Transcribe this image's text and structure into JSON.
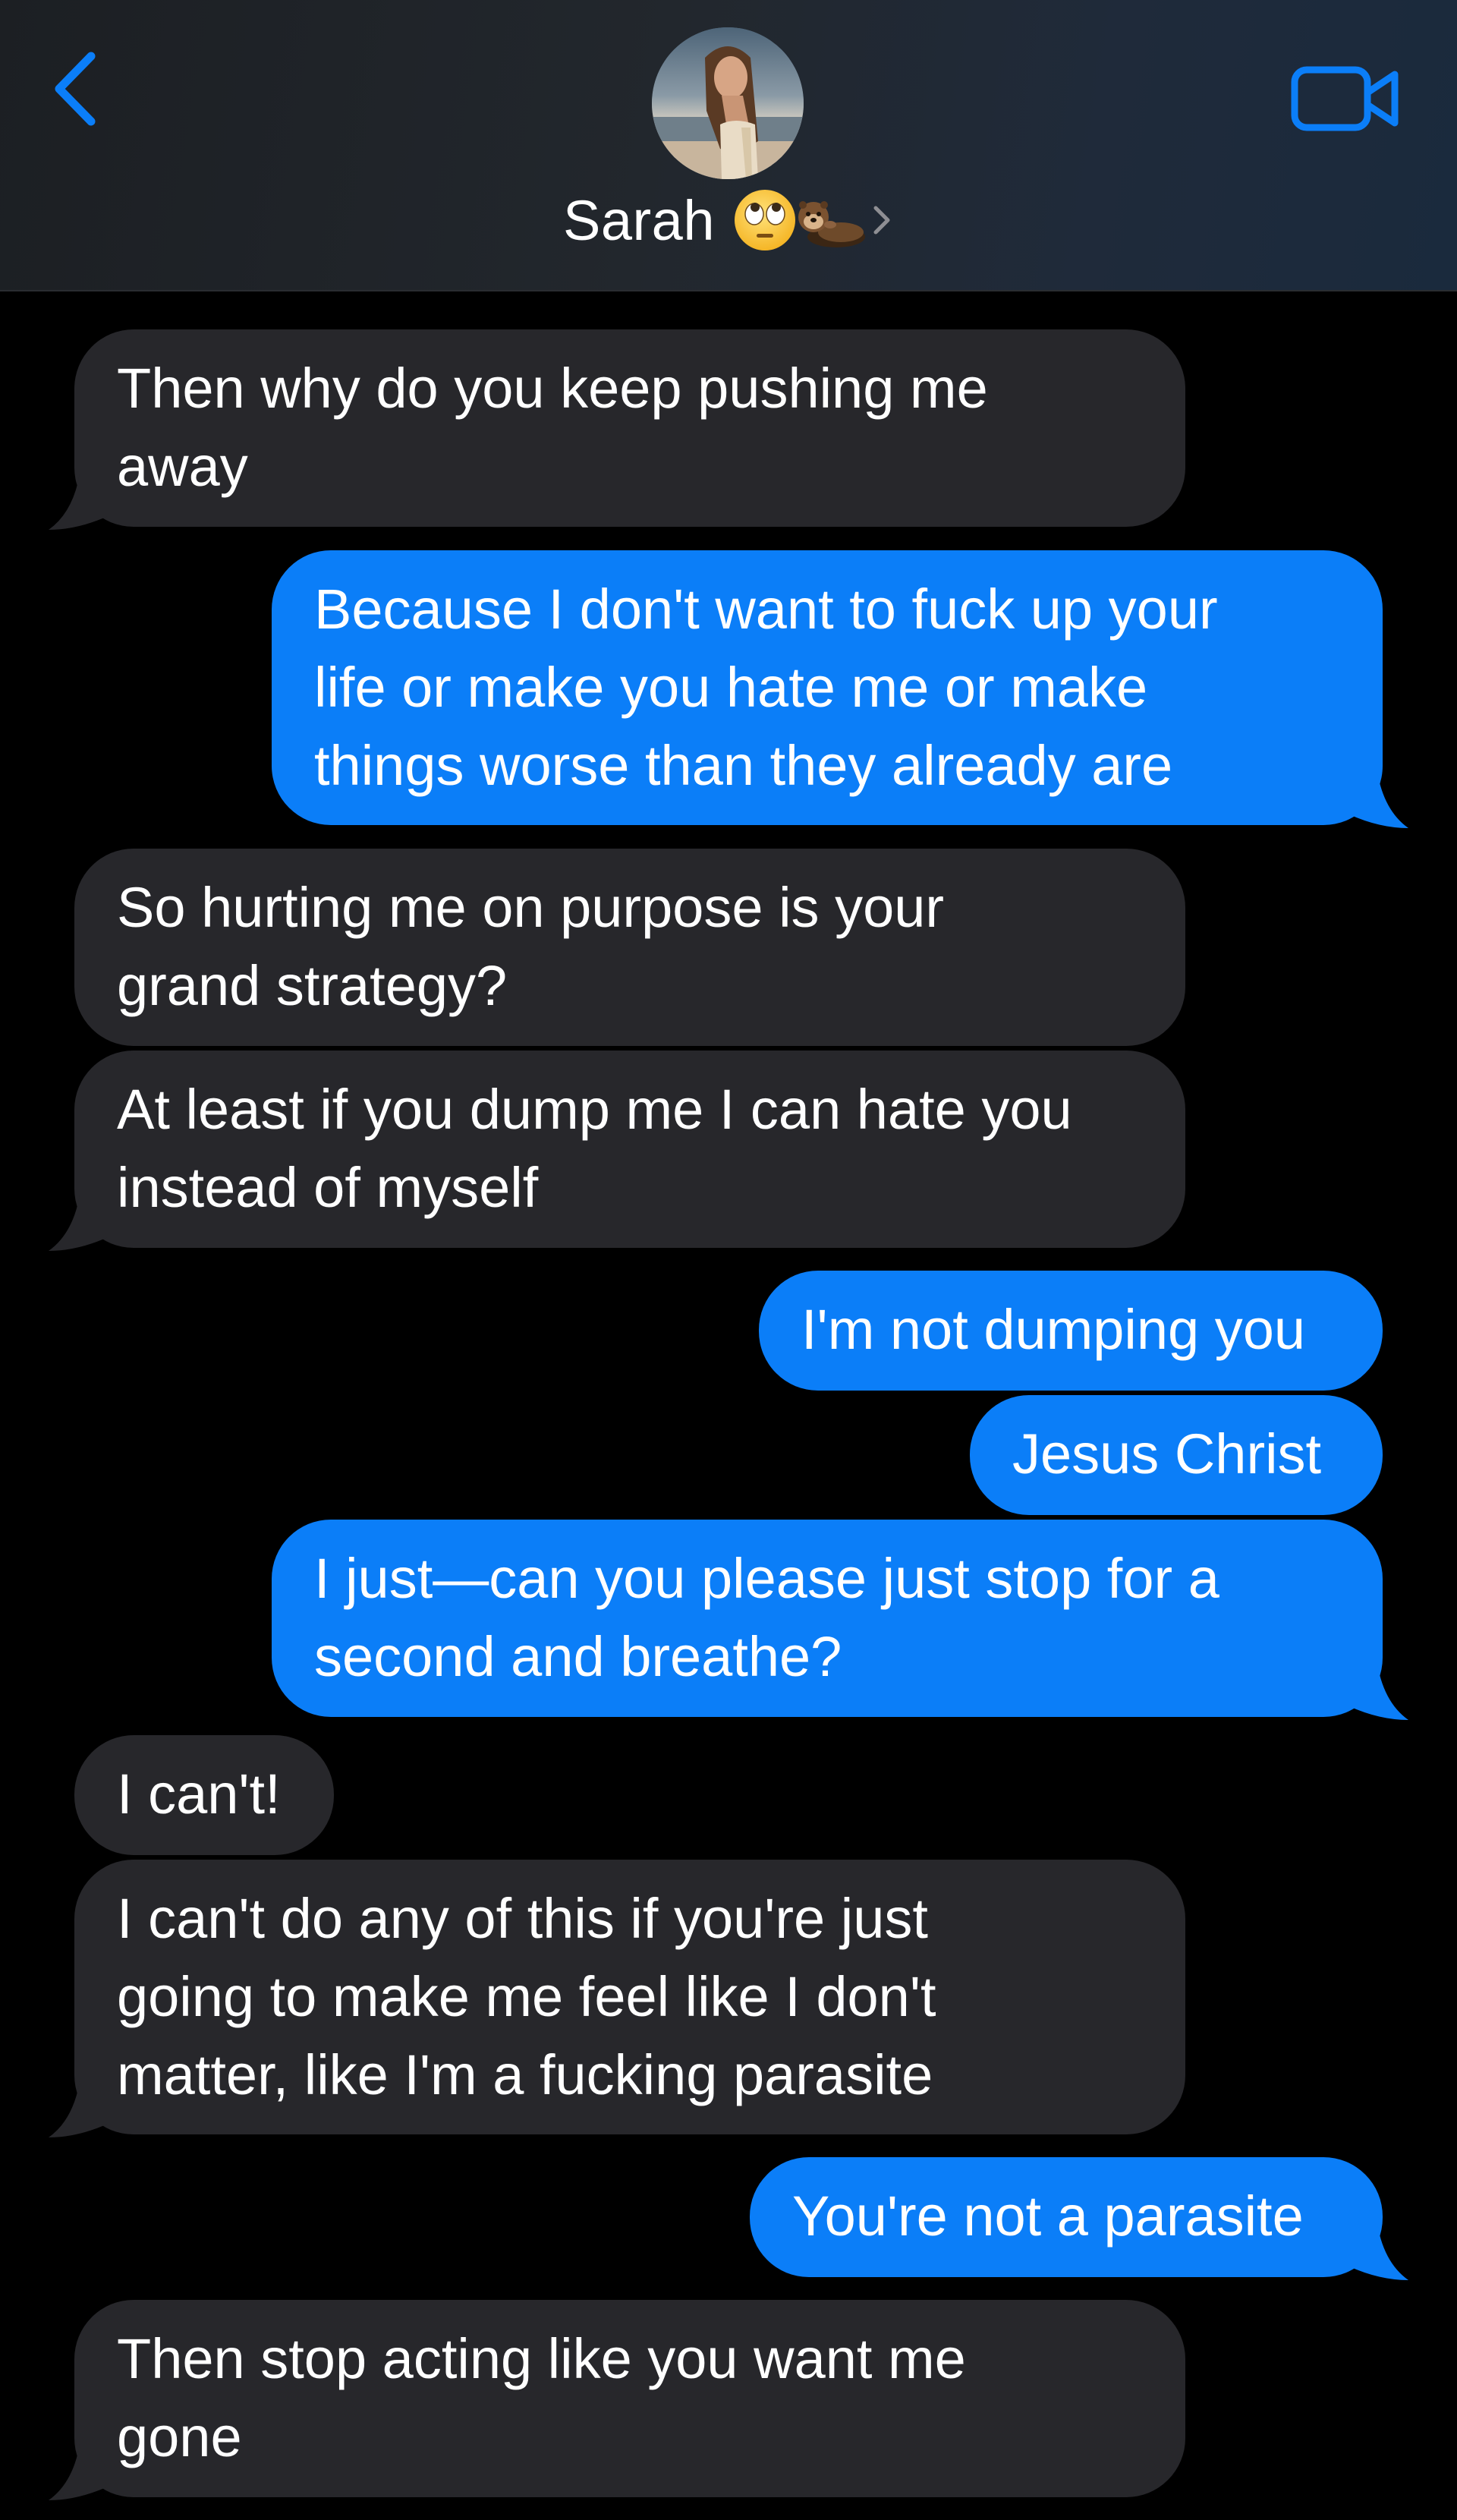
{
  "header": {
    "contact_name": "Sarah",
    "name_emojis": [
      "face-with-rolling-eyes-icon",
      "otter-icon"
    ],
    "back_icon": "chevron-left-icon",
    "video_icon": "video-camera-icon",
    "accent_color": "#0b7ef8"
  },
  "colors": {
    "incoming_bubble": "#27272b",
    "outgoing_bubble": "#0b7ef8",
    "background": "#000000"
  },
  "messages": [
    {
      "direction": "in",
      "lines": [
        "Then why do you keep pushing me",
        "away"
      ]
    },
    {
      "direction": "out",
      "lines": [
        "Because I don't want to fuck up your",
        "life or make you hate me or make",
        "things worse than they already are"
      ]
    },
    {
      "direction": "in",
      "lines": [
        "So hurting me on purpose is your",
        "grand strategy?"
      ]
    },
    {
      "direction": "in",
      "lines": [
        "At least if you dump me I can hate you",
        "instead of myself"
      ]
    },
    {
      "direction": "out",
      "lines": [
        "I'm not dumping you"
      ]
    },
    {
      "direction": "out",
      "lines": [
        "Jesus Christ"
      ]
    },
    {
      "direction": "out",
      "lines": [
        "I just—can you please just stop for a",
        "second and breathe?"
      ]
    },
    {
      "direction": "in",
      "lines": [
        "I can't!"
      ]
    },
    {
      "direction": "in",
      "lines": [
        "I can't do any of this if you're just",
        "going to make me feel like I don't",
        "matter, like I'm a fucking parasite"
      ]
    },
    {
      "direction": "out",
      "lines": [
        "You're not a parasite"
      ]
    },
    {
      "direction": "in",
      "lines": [
        "Then stop acting like you want me",
        "gone"
      ]
    }
  ]
}
